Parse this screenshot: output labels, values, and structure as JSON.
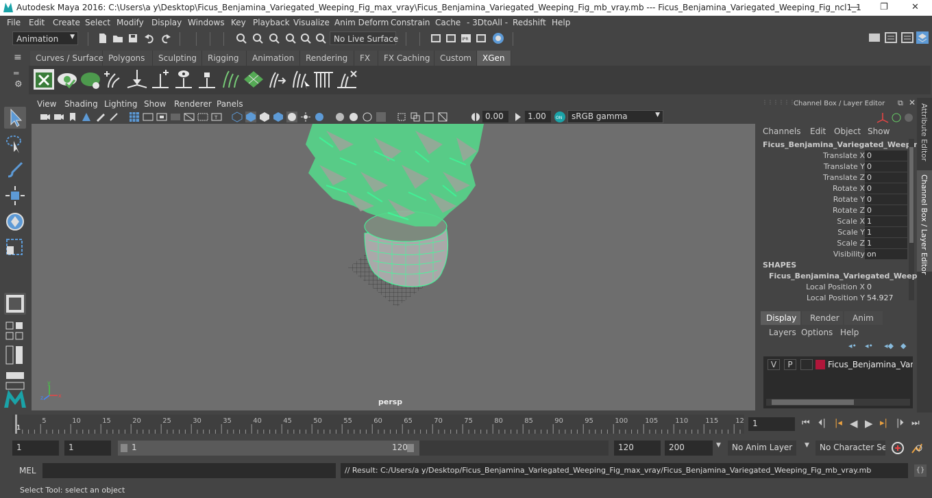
{
  "window": {
    "title": "Autodesk Maya 2016: C:\\Users\\a y\\Desktop\\Ficus_Benjamina_Variegated_Weeping_Fig_max_vray\\Ficus_Benjamina_Variegated_Weeping_Fig_mb_vray.mb   ---   Ficus_Benjamina_Variegated_Weeping_Fig_ncl1_1",
    "minimize": "—",
    "maximize": "❐",
    "close": "✕"
  },
  "menu": [
    "File",
    "Edit",
    "Create",
    "Select",
    "Modify",
    "Display",
    "Windows",
    "Key",
    "Playback",
    "Visualize",
    "Anim Deform",
    "Constrain",
    "Cache",
    "- 3DtoAll -",
    "Redshift",
    "Help"
  ],
  "status": {
    "mode": "Animation",
    "live_surface": "No Live Surface"
  },
  "shelf_tabs": [
    "Curves / Surfaces",
    "Polygons",
    "Sculpting",
    "Rigging",
    "Animation",
    "Rendering",
    "FX",
    "FX Caching",
    "Custom",
    "XGen"
  ],
  "active_shelf": "XGen",
  "panel_menu": [
    "View",
    "Shading",
    "Lighting",
    "Show",
    "Renderer",
    "Panels"
  ],
  "panel_toolbar": {
    "exposure": "0.00",
    "gamma": "1.00",
    "color_space": "sRGB gamma"
  },
  "viewport": {
    "camera": "persp"
  },
  "channel_box": {
    "title": "Channel Box / Layer Editor",
    "menu": [
      "Channels",
      "Edit",
      "Object",
      "Show"
    ],
    "object_name": "Ficus_Benjamina_Variegated_Weepin...",
    "attributes": [
      {
        "label": "Translate X",
        "value": "0"
      },
      {
        "label": "Translate Y",
        "value": "0"
      },
      {
        "label": "Translate Z",
        "value": "0"
      },
      {
        "label": "Rotate X",
        "value": "0"
      },
      {
        "label": "Rotate Y",
        "value": "0"
      },
      {
        "label": "Rotate Z",
        "value": "0"
      },
      {
        "label": "Scale X",
        "value": "1"
      },
      {
        "label": "Scale Y",
        "value": "1"
      },
      {
        "label": "Scale Z",
        "value": "1"
      },
      {
        "label": "Visibility",
        "value": "on"
      }
    ],
    "shapes_header": "SHAPES",
    "shape_name": "Ficus_Benjamina_Variegated_Weepi...",
    "shape_attributes": [
      {
        "label": "Local Position X",
        "value": "0"
      },
      {
        "label": "Local Position Y",
        "value": "54.927"
      }
    ]
  },
  "layer_editor": {
    "tabs": [
      "Display",
      "Render",
      "Anim"
    ],
    "menu": [
      "Layers",
      "Options",
      "Help"
    ],
    "layer": {
      "v": "V",
      "p": "P",
      "name": "Ficus_Benjamina_Variega",
      "color": "#b0163a"
    }
  },
  "side_tabs": [
    "Attribute Editor",
    "Channel Box / Layer Editor"
  ],
  "timeline": {
    "ticks": [
      "5",
      "10",
      "15",
      "20",
      "25",
      "30",
      "35",
      "40",
      "45",
      "50",
      "55",
      "60",
      "65",
      "70",
      "75",
      "80",
      "85",
      "90",
      "95",
      "100",
      "105",
      "110",
      "115",
      "12"
    ],
    "start_marker": "1",
    "current_frame": "1"
  },
  "range": {
    "start": "1",
    "playback_start": "1",
    "slider_start": "1",
    "slider_end": "120",
    "playback_end": "120",
    "end": "200",
    "anim_layer": "No Anim Layer",
    "character_set": "No Character Set"
  },
  "command": {
    "lang": "MEL",
    "result": "// Result: C:/Users/a y/Desktop/Ficus_Benjamina_Variegated_Weeping_Fig_max_vray/Ficus_Benjamina_Variegated_Weeping_Fig_mb_vray.mb"
  },
  "help_line": "Select Tool: select an object",
  "colors": {
    "wireframe": "#3dff9a",
    "layer_swatch": "#b0163a",
    "accent": "#5d9ad6"
  }
}
